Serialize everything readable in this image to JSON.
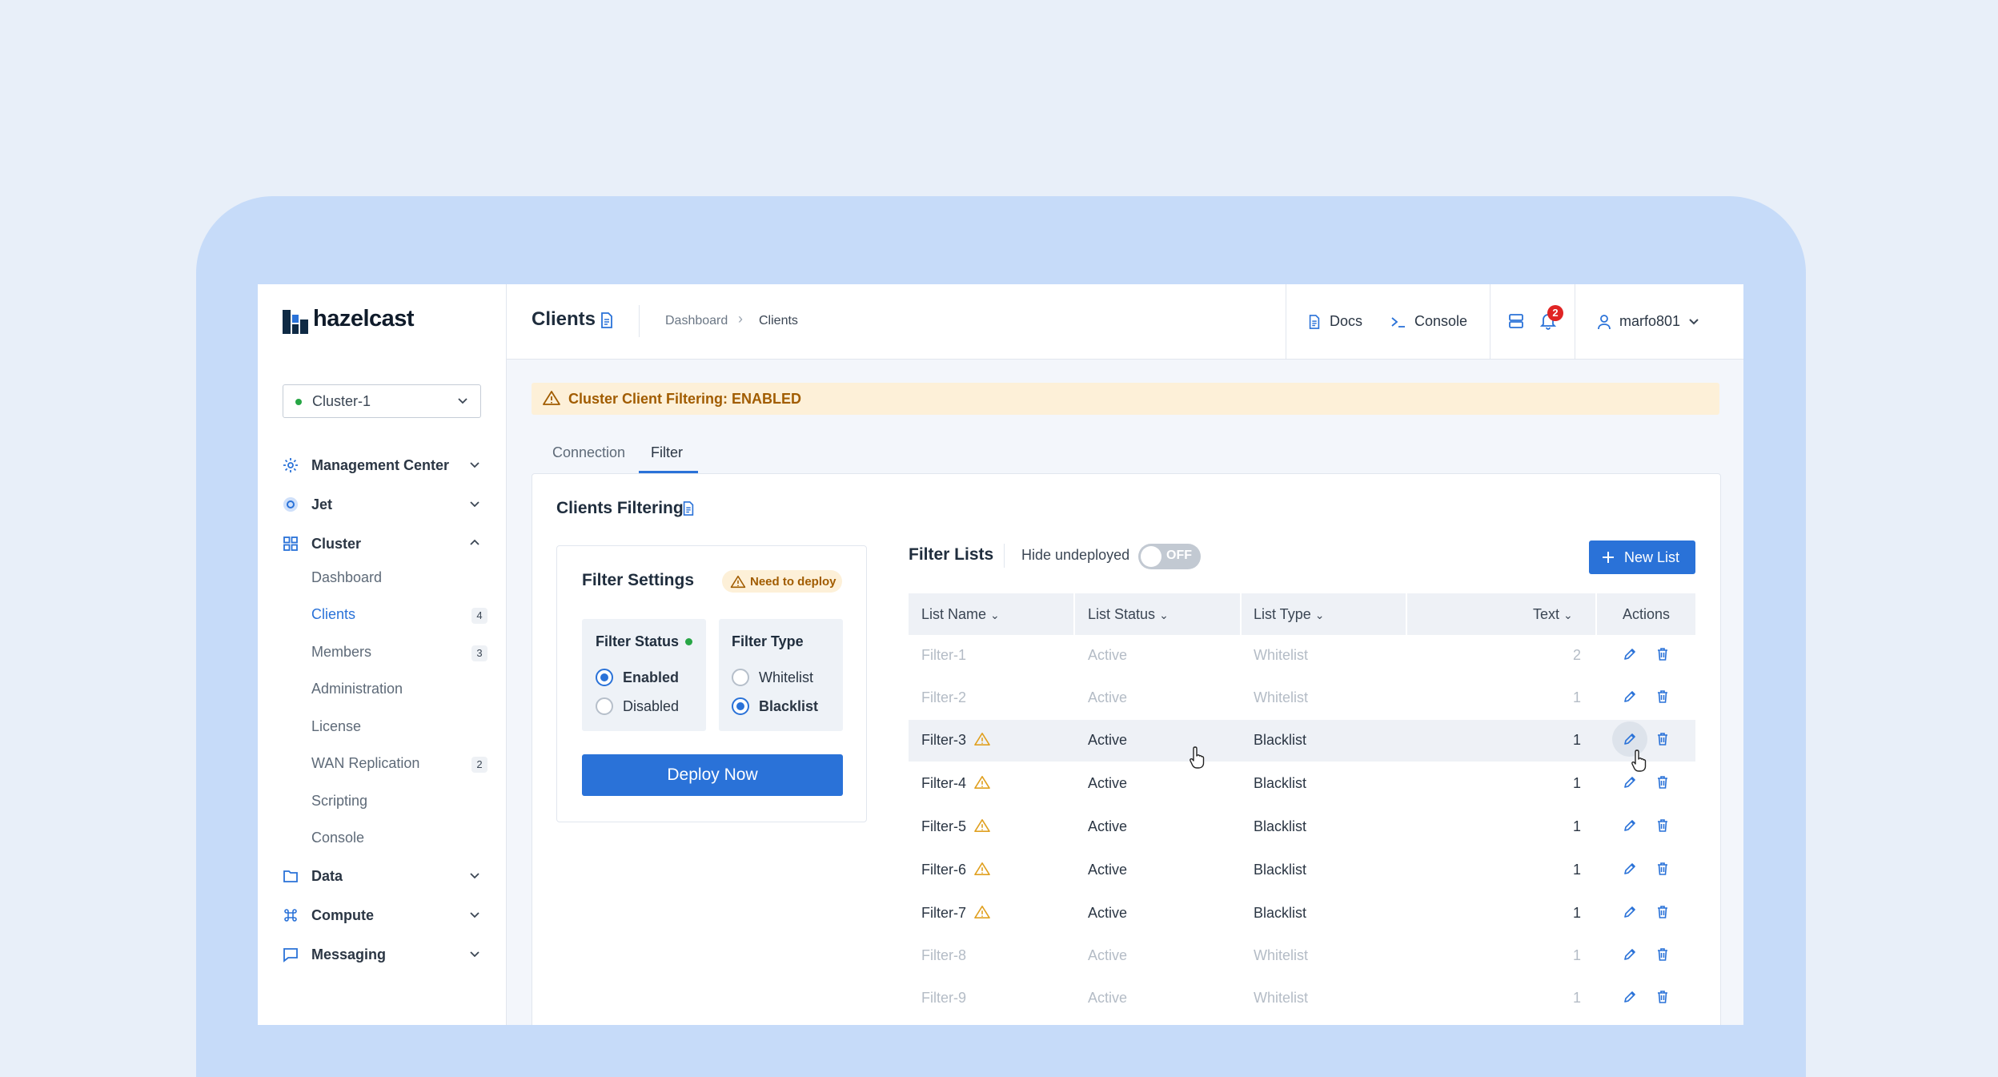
{
  "brand": {
    "name": "hazelcast"
  },
  "header": {
    "title": "Clients",
    "breadcrumb": [
      "Dashboard",
      "Clients"
    ],
    "docs_label": "Docs",
    "console_label": "Console",
    "notification_count": "2",
    "user": "marfo801"
  },
  "sidebar": {
    "cluster": "Cluster-1",
    "groups": [
      {
        "label": "Management Center",
        "icon": "gear-icon"
      },
      {
        "label": "Jet",
        "icon": "jet-icon"
      },
      {
        "label": "Cluster",
        "icon": "grid-icon"
      },
      {
        "label": "Data",
        "icon": "folder-icon"
      },
      {
        "label": "Compute",
        "icon": "command-icon"
      },
      {
        "label": "Messaging",
        "icon": "chat-icon"
      }
    ],
    "cluster_items": [
      {
        "label": "Dashboard",
        "count": ""
      },
      {
        "label": "Clients",
        "count": "4"
      },
      {
        "label": "Members",
        "count": "3"
      },
      {
        "label": "Administration",
        "count": ""
      },
      {
        "label": "License",
        "count": ""
      },
      {
        "label": "WAN Replication",
        "count": "2"
      },
      {
        "label": "Scripting",
        "count": ""
      },
      {
        "label": "Console",
        "count": ""
      }
    ]
  },
  "alert": {
    "text": "Cluster Client Filtering: ENABLED"
  },
  "tabs": [
    "Connection",
    "Filter"
  ],
  "filtering": {
    "title": "Clients Filtering",
    "settings": {
      "title": "Filter Settings",
      "badge": "Need to deploy",
      "status_title": "Filter Status",
      "status_options": [
        "Enabled",
        "Disabled"
      ],
      "type_title": "Filter Type",
      "type_options": [
        "Whitelist",
        "Blacklist"
      ],
      "deploy_label": "Deploy Now"
    },
    "lists": {
      "title": "Filter Lists",
      "hide_label": "Hide undeployed",
      "toggle_text": "OFF",
      "new_label": "New List",
      "columns": [
        "List Name",
        "List Status",
        "List Type",
        "Text",
        "Actions"
      ],
      "rows": [
        {
          "name": "Filter-1",
          "status": "Active",
          "type": "Whitelist",
          "text": "2"
        },
        {
          "name": "Filter-2",
          "status": "Active",
          "type": "Whitelist",
          "text": "1"
        },
        {
          "name": "Filter-3",
          "status": "Active",
          "type": "Blacklist",
          "text": "1"
        },
        {
          "name": "Filter-4",
          "status": "Active",
          "type": "Blacklist",
          "text": "1"
        },
        {
          "name": "Filter-5",
          "status": "Active",
          "type": "Blacklist",
          "text": "1"
        },
        {
          "name": "Filter-6",
          "status": "Active",
          "type": "Blacklist",
          "text": "1"
        },
        {
          "name": "Filter-7",
          "status": "Active",
          "type": "Blacklist",
          "text": "1"
        },
        {
          "name": "Filter-8",
          "status": "Active",
          "type": "Whitelist",
          "text": "1"
        },
        {
          "name": "Filter-9",
          "status": "Active",
          "type": "Whitelist",
          "text": "1"
        }
      ]
    }
  },
  "colors": {
    "accent": "#2a72d8",
    "warning": "#e0a020",
    "success": "#27a645",
    "danger": "#e02424"
  }
}
